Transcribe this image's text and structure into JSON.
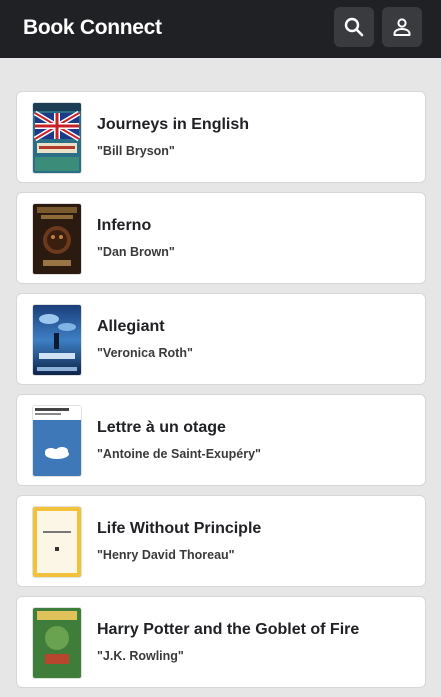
{
  "app": {
    "title": "Book Connect",
    "header_color": "#202125",
    "search_icon": "search-icon",
    "profile_icon": "user-icon"
  },
  "books": [
    {
      "title": "Journeys in English",
      "author": "\"Bill Bryson\"",
      "cover": "union-jack-cover"
    },
    {
      "title": "Inferno",
      "author": "\"Dan Brown\"",
      "cover": "dark-face-cover"
    },
    {
      "title": "Allegiant",
      "author": "\"Veronica Roth\"",
      "cover": "blue-sky-cover"
    },
    {
      "title": "Lettre à un otage",
      "author": "\"Antoine de Saint-Exupéry\"",
      "cover": "cloud-cover"
    },
    {
      "title": "Life Without Principle",
      "author": "\"Henry David Thoreau\"",
      "cover": "yellow-cover"
    },
    {
      "title": "Harry Potter and the Goblet of Fire",
      "author": "\"J.K. Rowling\"",
      "cover": "green-cover"
    }
  ]
}
